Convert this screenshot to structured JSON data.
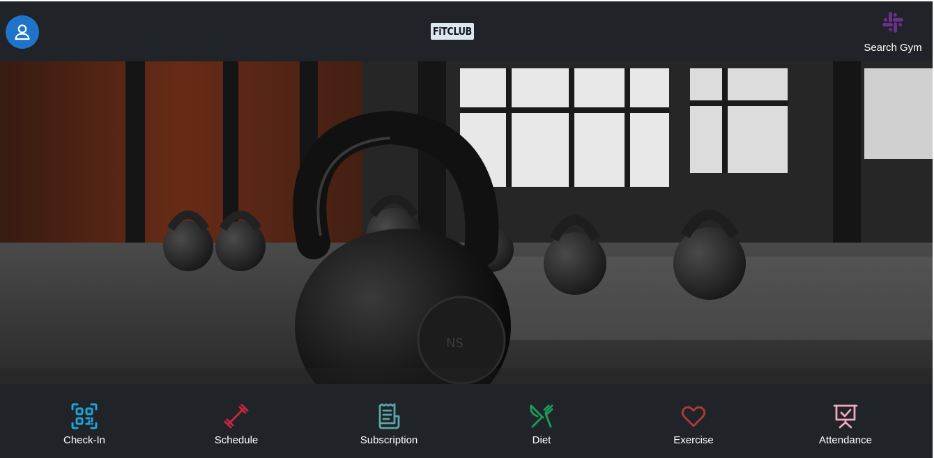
{
  "header": {
    "brand": "FiTCLUB",
    "search_label": "Search Gym",
    "avatar_color": "#1f73c9",
    "search_icon_color": "#6b2f8e"
  },
  "hero": {
    "image": "gym-kettlebell-photo"
  },
  "bottom_nav": {
    "items": [
      {
        "label": "Check-In",
        "icon": "qr-code-icon",
        "color": "#1ea4d6"
      },
      {
        "label": "Schedule",
        "icon": "dumbbell-icon",
        "color": "#c5283d"
      },
      {
        "label": "Subscription",
        "icon": "receipt-icon",
        "color": "#5aa6a8"
      },
      {
        "label": "Diet",
        "icon": "fork-knife-icon",
        "color": "#1d9a5b"
      },
      {
        "label": "Exercise",
        "icon": "heart-icon",
        "color": "#a83b3b"
      },
      {
        "label": "Attendance",
        "icon": "presentation-board-icon",
        "color": "#f3a8c0"
      }
    ]
  }
}
